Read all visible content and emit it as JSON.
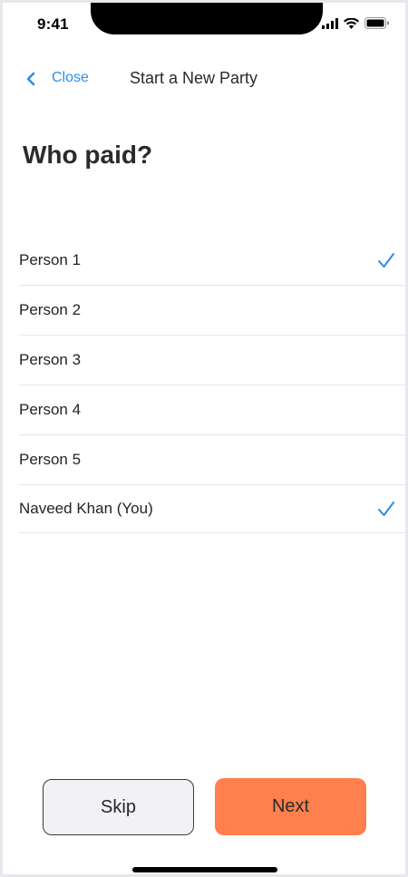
{
  "status_bar": {
    "time": "9:41",
    "icons": [
      "cellular-signal-icon",
      "wifi-icon",
      "battery-icon"
    ]
  },
  "nav": {
    "back_label": "Close",
    "title": "Start a New Party"
  },
  "heading": "Who paid?",
  "people": [
    {
      "name": "Person 1",
      "selected": true
    },
    {
      "name": "Person 2",
      "selected": false
    },
    {
      "name": "Person 3",
      "selected": false
    },
    {
      "name": "Person 4",
      "selected": false
    },
    {
      "name": "Person 5",
      "selected": false
    },
    {
      "name": "Naveed Khan (You)",
      "selected": true
    }
  ],
  "buttons": {
    "skip_label": "Skip",
    "next_label": "Next"
  },
  "colors": {
    "accent": "#2d8ce6",
    "primary_button": "#ff7f4d",
    "secondary_button": "#f1f1f6"
  }
}
